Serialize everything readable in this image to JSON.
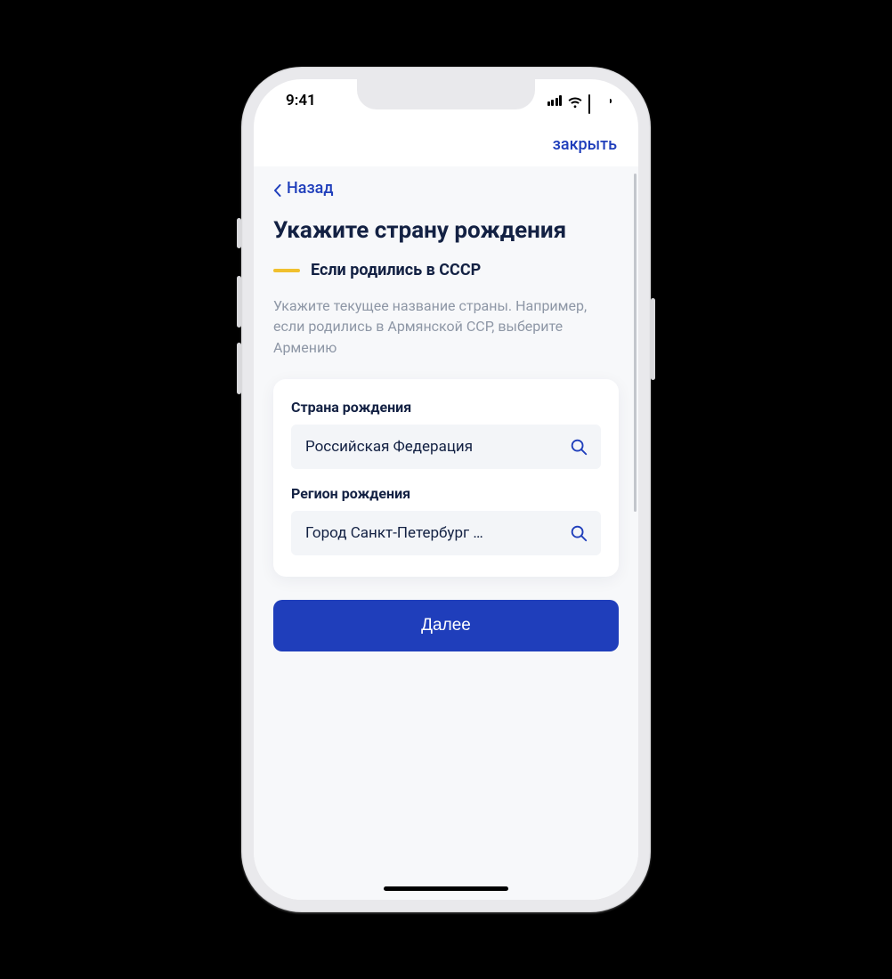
{
  "status": {
    "time": "9:41"
  },
  "topbar": {
    "close": "закрыть"
  },
  "nav": {
    "back": "Назад"
  },
  "page": {
    "title": "Укажите страну рождения",
    "subtitle": "Если родились в СССР",
    "help": "Укажите текущее название страны. Например, если родились в Армянской ССР, выберите Армению"
  },
  "form": {
    "country": {
      "label": "Страна рождения",
      "value": "Российская Федерация"
    },
    "region": {
      "label": "Регион рождения",
      "value": "Город Санкт-Петербург …"
    }
  },
  "actions": {
    "next": "Далее"
  },
  "colors": {
    "accent": "#1f3ebb",
    "highlight": "#f0c02e"
  }
}
